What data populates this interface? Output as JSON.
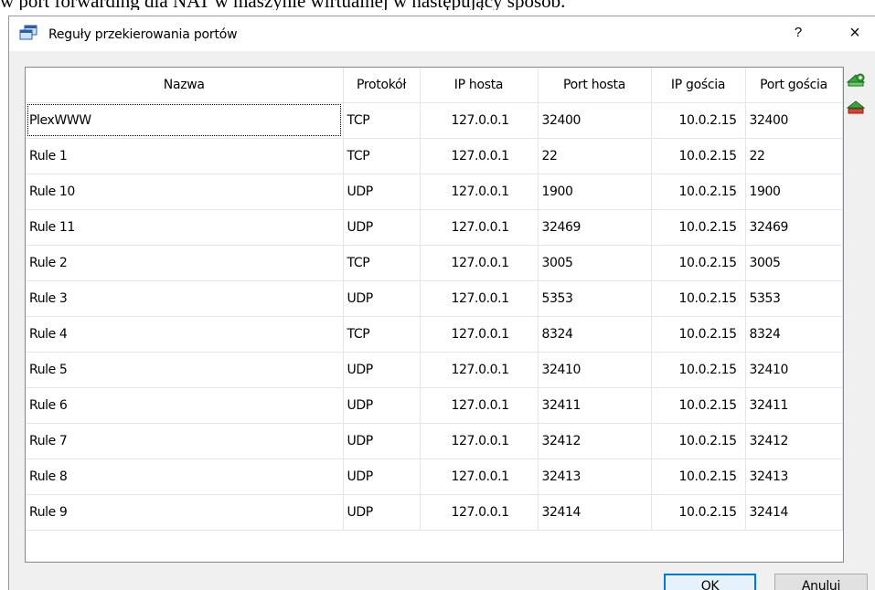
{
  "background_text": "w port forwarding dla NAT w maszynie wirtualnej w następujący sposób.",
  "dialog": {
    "title": "Reguły przekierowania portów",
    "help_label": "?",
    "close_label": "×"
  },
  "table": {
    "headers": [
      "Nazwa",
      "Protokół",
      "IP hosta",
      "Port hosta",
      "IP gościa",
      "Port gościa"
    ],
    "rows": [
      [
        "PlexWWW",
        "TCP",
        "127.0.0.1",
        "32400",
        "10.0.2.15",
        "32400"
      ],
      [
        "Rule 1",
        "TCP",
        "127.0.0.1",
        "22",
        "10.0.2.15",
        "22"
      ],
      [
        "Rule 10",
        "UDP",
        "127.0.0.1",
        "1900",
        "10.0.2.15",
        "1900"
      ],
      [
        "Rule 11",
        "UDP",
        "127.0.0.1",
        "32469",
        "10.0.2.15",
        "32469"
      ],
      [
        "Rule 2",
        "TCP",
        "127.0.0.1",
        "3005",
        "10.0.2.15",
        "3005"
      ],
      [
        "Rule 3",
        "UDP",
        "127.0.0.1",
        "5353",
        "10.0.2.15",
        "5353"
      ],
      [
        "Rule 4",
        "TCP",
        "127.0.0.1",
        "8324",
        "10.0.2.15",
        "8324"
      ],
      [
        "Rule 5",
        "UDP",
        "127.0.0.1",
        "32410",
        "10.0.2.15",
        "32410"
      ],
      [
        "Rule 6",
        "UDP",
        "127.0.0.1",
        "32411",
        "10.0.2.15",
        "32411"
      ],
      [
        "Rule 7",
        "UDP",
        "127.0.0.1",
        "32412",
        "10.0.2.15",
        "32412"
      ],
      [
        "Rule 8",
        "UDP",
        "127.0.0.1",
        "32413",
        "10.0.2.15",
        "32413"
      ],
      [
        "Rule 9",
        "UDP",
        "127.0.0.1",
        "32414",
        "10.0.2.15",
        "32414"
      ]
    ]
  },
  "side_icons": [
    "add-rule-icon",
    "remove-rule-icon"
  ],
  "buttons": {
    "ok": "OK",
    "cancel": "Anuluj"
  },
  "colors": {
    "accent": "#0078d7",
    "add_icon": "#3aa53a",
    "remove_icon": "#d9433a"
  }
}
